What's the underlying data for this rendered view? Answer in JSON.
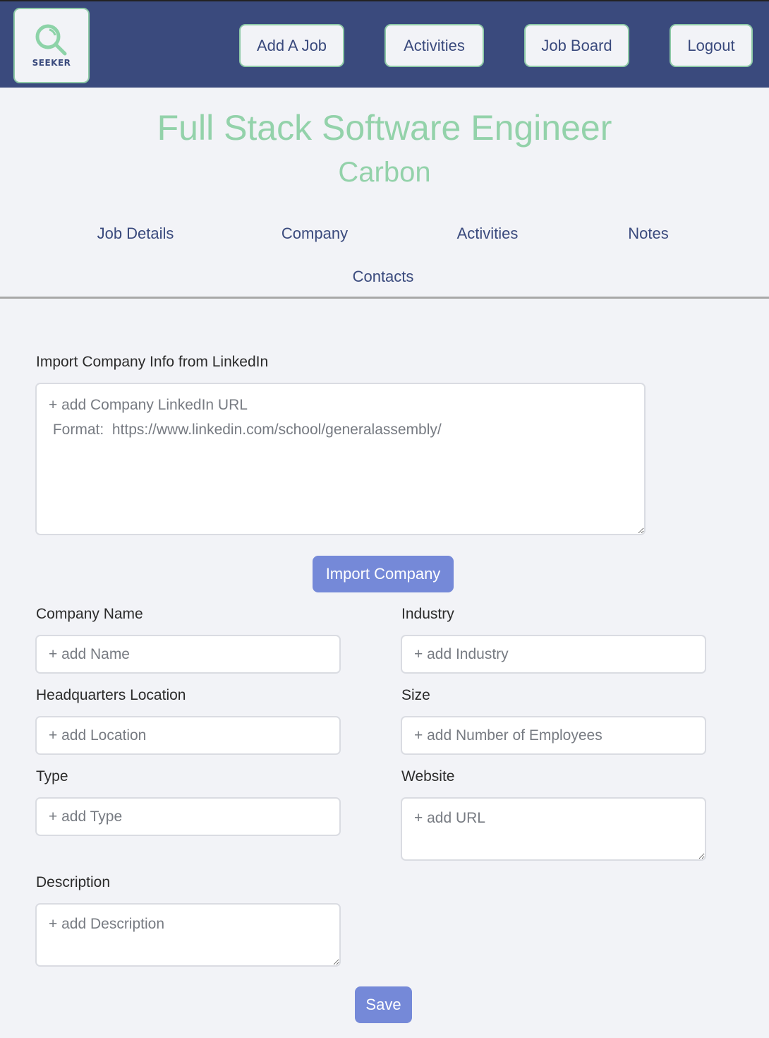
{
  "app": {
    "logo_text": "SEEKER",
    "colors": {
      "navbar": "#3a4a7d",
      "accent_green": "#93d2aa",
      "primary_button": "#7589d8",
      "background": "#f2f3f7"
    }
  },
  "navbar": {
    "buttons": [
      {
        "label": "Add A Job"
      },
      {
        "label": "Activities"
      },
      {
        "label": "Job Board"
      },
      {
        "label": "Logout"
      }
    ]
  },
  "header": {
    "job_title": "Full Stack Software Engineer",
    "company": "Carbon"
  },
  "tabs": [
    {
      "label": "Job Details"
    },
    {
      "label": "Company"
    },
    {
      "label": "Activities"
    },
    {
      "label": "Notes"
    },
    {
      "label": "Contacts"
    }
  ],
  "form": {
    "linkedin_import": {
      "label": "Import Company Info from LinkedIn",
      "placeholder": "+ add Company LinkedIn URL\n Format:  https://www.linkedin.com/school/generalassembly/",
      "button_label": "Import Company"
    },
    "fields": {
      "company_name": {
        "label": "Company Name",
        "placeholder": "+ add Name"
      },
      "industry": {
        "label": "Industry",
        "placeholder": "+ add Industry"
      },
      "hq_location": {
        "label": "Headquarters Location",
        "placeholder": "+ add Location"
      },
      "size": {
        "label": "Size",
        "placeholder": "+ add Number of Employees"
      },
      "type": {
        "label": "Type",
        "placeholder": "+ add Type"
      },
      "website": {
        "label": "Website",
        "placeholder": "+ add URL"
      },
      "description": {
        "label": "Description",
        "placeholder": "+ add Description"
      }
    },
    "save_label": "Save"
  }
}
